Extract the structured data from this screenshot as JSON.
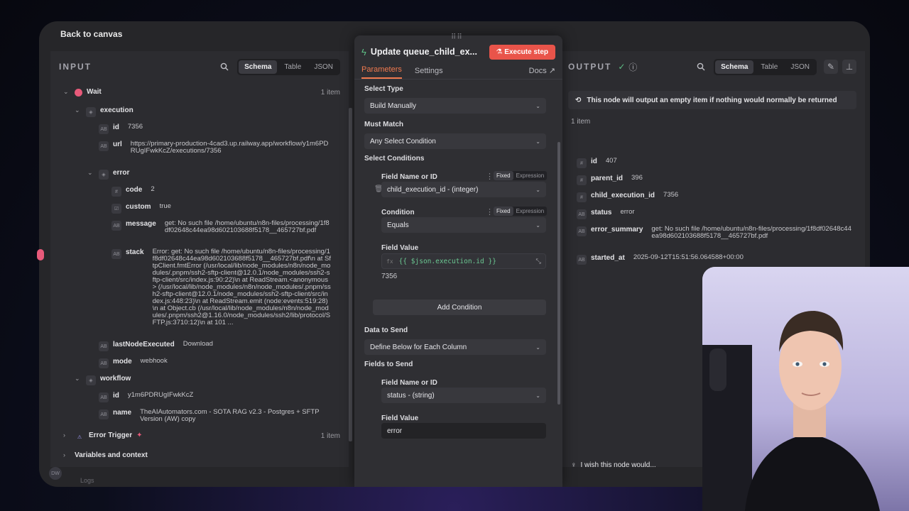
{
  "topbar": {
    "back_label": "Back to canvas"
  },
  "input": {
    "title": "INPUT",
    "tabs": [
      "Schema",
      "Table",
      "JSON"
    ],
    "wait": {
      "label": "Wait",
      "count": "1 item"
    },
    "execution": "execution",
    "id": {
      "key": "id",
      "value": "7356"
    },
    "url": {
      "key": "url",
      "value": "https://primary-production-4cad3.up.railway.app/workflow/y1m6PDRUgIFwkKcZ/executions/7356"
    },
    "error": "error",
    "code": {
      "key": "code",
      "value": "2"
    },
    "custom": {
      "key": "custom",
      "value": "true"
    },
    "message": {
      "key": "message",
      "value": "get: No such file /home/ubuntu/n8n-files/processing/1f8df02648c44ea98d602103688f5178__465727bf.pdf"
    },
    "stack": {
      "key": "stack",
      "value": "Error: get: No such file /home/ubuntu/n8n-files/processing/1f8df02648c44ea98d602103688f5178__465727bf.pdf\\n at SftpClient.fmtError (/usr/local/lib/node_modules/n8n/node_modules/.pnpm/ssh2-sftp-client@12.0.1/node_modules/ssh2-sftp-client/src/index.js:90:22)\\n at ReadStream.<anonymous> (/usr/local/lib/node_modules/n8n/node_modules/.pnpm/ssh2-sftp-client@12.0.1/node_modules/ssh2-sftp-client/src/index.js:448:23)\\n at ReadStream.emit (node:events:519:28)\\n at Object.cb (/usr/local/lib/node_modules/n8n/node_modules/.pnpm/ssh2@1.16.0/node_modules/ssh2/lib/protocol/SFTP.js:3710:12)\\n at 101 ..."
    },
    "lastNodeExecuted": {
      "key": "lastNodeExecuted",
      "value": "Download"
    },
    "mode": {
      "key": "mode",
      "value": "webhook"
    },
    "workflow": "workflow",
    "wf_id": {
      "key": "id",
      "value": "y1m6PDRUgIFwkKcZ"
    },
    "wf_name": {
      "key": "name",
      "value": "TheAIAutomators.com - SOTA RAG v2.3 - Postgres + SFTP Version (AW) copy"
    },
    "error_trigger": {
      "label": "Error Trigger",
      "count": "1 item"
    },
    "vars": "Variables and context"
  },
  "node": {
    "title": "Update queue_child_ex...",
    "execute_label": "Execute step",
    "tabs": {
      "parameters": "Parameters",
      "settings": "Settings",
      "docs": "Docs"
    },
    "select_type": {
      "label": "Select Type",
      "value": "Build Manually"
    },
    "must_match": {
      "label": "Must Match",
      "value": "Any Select Condition"
    },
    "select_conditions": "Select Conditions",
    "field_name": {
      "label": "Field Name or ID",
      "value": "child_execution_id - (integer)"
    },
    "condition": {
      "label": "Condition",
      "value": "Equals"
    },
    "field_value": {
      "label": "Field Value",
      "expr": "{{ $json.execution.id }}",
      "result": "7356"
    },
    "fixed": "Fixed",
    "expression": "Expression",
    "add_condition": "Add Condition",
    "data_to_send": {
      "label": "Data to Send",
      "value": "Define Below for Each Column"
    },
    "fields_to_send": "Fields to Send",
    "field_name2": {
      "label": "Field Name or ID",
      "value": "status - (string)"
    },
    "field_value2": {
      "label": "Field Value",
      "value": "error"
    }
  },
  "output": {
    "title": "OUTPUT",
    "tabs": [
      "Schema",
      "Table",
      "JSON"
    ],
    "notice": "This node will output an empty item if nothing would normally be returned",
    "count": "1 item",
    "fields": [
      {
        "type": "#",
        "key": "id",
        "value": "407"
      },
      {
        "type": "#",
        "key": "parent_id",
        "value": "396"
      },
      {
        "type": "#",
        "key": "child_execution_id",
        "value": "7356"
      },
      {
        "type": "AB",
        "key": "status",
        "value": "error"
      },
      {
        "type": "AB",
        "key": "error_summary",
        "value": "get: No such file /home/ubuntu/n8n-files/processing/1f8df02648c44ea98d602103688f5178__465727bf.pdf"
      },
      {
        "type": "AB",
        "key": "started_at",
        "value": "2025-09-12T15:51:56.064588+00:00"
      }
    ],
    "wish": "I wish this node would..."
  },
  "footer": {
    "logs": "Logs"
  },
  "colors": {
    "accent": "#f17a4f",
    "execute": "#e9544a",
    "expr_green": "#6bc892"
  }
}
